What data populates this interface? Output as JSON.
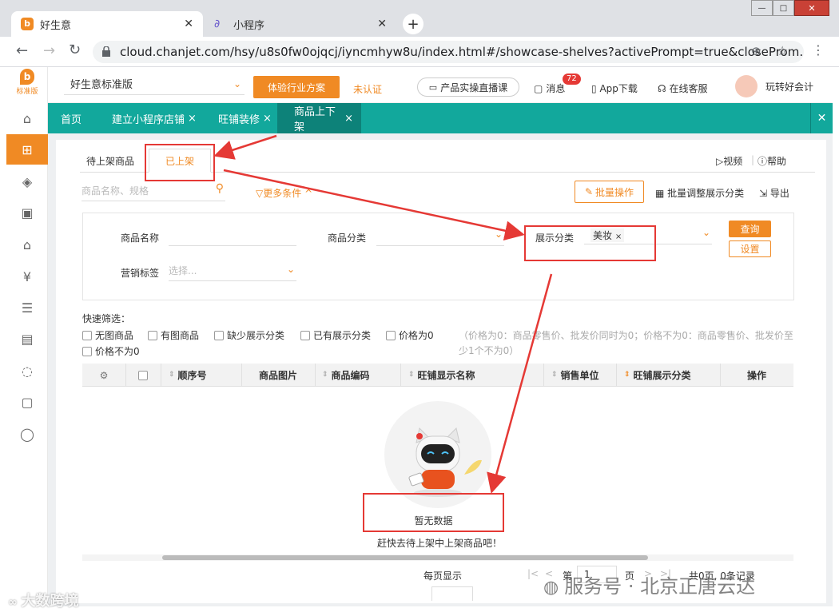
{
  "browser": {
    "tabs": [
      {
        "title": "好生意",
        "active": true
      },
      {
        "title": "小程序",
        "active": false
      }
    ],
    "new_tab": "+",
    "url": "cloud.chanjet.com/hsy/u8s0fw0ojqcj/iyncmhyw8u/index.html#/showcase-shelves?activePrompt=true&closeProm...",
    "window_controls": {
      "min": "—",
      "max": "□",
      "close": "✕"
    }
  },
  "app": {
    "logo_badge": "标准版",
    "edition": "好生意标准版",
    "trial_btn": "体验行业方案",
    "unverified": "未认证",
    "live_course": "产品实操直播课",
    "messages": "消息",
    "message_count": "72",
    "app_download": "App下载",
    "online_service": "在线客服",
    "user": "玩转好会计"
  },
  "app_tabs": [
    {
      "label": "首页",
      "closable": false,
      "active": false
    },
    {
      "label": "建立小程序店铺",
      "closable": true,
      "active": false
    },
    {
      "label": "旺铺装修",
      "closable": true,
      "active": false
    },
    {
      "label": "商品上下架",
      "closable": true,
      "active": true
    }
  ],
  "page": {
    "sub_tabs": [
      "待上架商品",
      "已上架"
    ],
    "video": "视频",
    "help": "帮助",
    "search_placeholder": "商品名称、规格",
    "more_conditions": "更多条件",
    "batch_op": "批量操作",
    "batch_adjust": "批量调整展示分类",
    "export": "导出",
    "filters": {
      "product_name_label": "商品名称",
      "product_category_label": "商品分类",
      "display_category_label": "展示分类",
      "display_category_tag": "美妆",
      "marketing_tag_label": "营销标签",
      "marketing_tag_placeholder": "选择...",
      "query_btn": "查询",
      "settings_btn": "设置"
    },
    "quick_filter_title": "快速筛选：",
    "quick_filters": [
      "无图商品",
      "有图商品",
      "缺少展示分类",
      "已有展示分类",
      "价格为0",
      "价格不为0"
    ],
    "price_note": "（价格为0：商品零售价、批发价同时为0；价格不为0：商品零售价、批发价至少1个不为0）",
    "columns": [
      "顺序号",
      "商品图片",
      "商品编码",
      "旺铺显示名称",
      "销售单位",
      "旺铺展示分类",
      "操作"
    ],
    "empty_title": "暂无数据",
    "empty_hint": "赶快去待上架中上架商品吧！",
    "pagination": {
      "per_page": "每页显示",
      "page_prefix": "第",
      "page_value": "1",
      "page_suffix": "页",
      "total": "共0页, 0条记录"
    }
  },
  "watermarks": {
    "left": "大数跨境",
    "right": "服务号 · 北京正唐云达"
  },
  "colors": {
    "accent": "#f08a24",
    "teal": "#12a89c",
    "annotation": "#e53935"
  }
}
